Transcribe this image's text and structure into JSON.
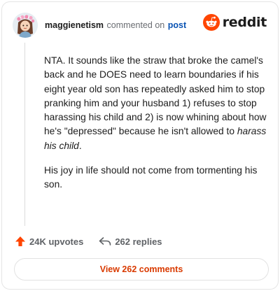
{
  "header": {
    "username": "maggienetism",
    "action": "commented on",
    "post_link": "post",
    "brand": "reddit"
  },
  "comment": {
    "p1_a": "NTA. It sounds like the straw that broke the camel's back and he DOES need to learn boundaries if his eight year old son has repeatedly asked him to stop pranking him and your husband 1) refuses to stop harassing his child and 2) is now whining about how he's \"depressed\" because he isn't allowed to ",
    "p1_emph": "harass his child",
    "p1_end": ".",
    "p2": "His joy in life should not come from tormenting his son."
  },
  "footer": {
    "upvotes": "24K upvotes",
    "replies": "262 replies"
  },
  "view_button": "View 262 comments",
  "colors": {
    "brand": "#ff4500",
    "upvote": "#ff4500",
    "link": "#0a53b3",
    "button_text": "#d93a00"
  },
  "icons": {
    "avatar": "avatar-icon",
    "brand": "reddit-logo-icon",
    "upvote": "upvote-arrow-icon",
    "reply": "reply-arrow-icon"
  }
}
